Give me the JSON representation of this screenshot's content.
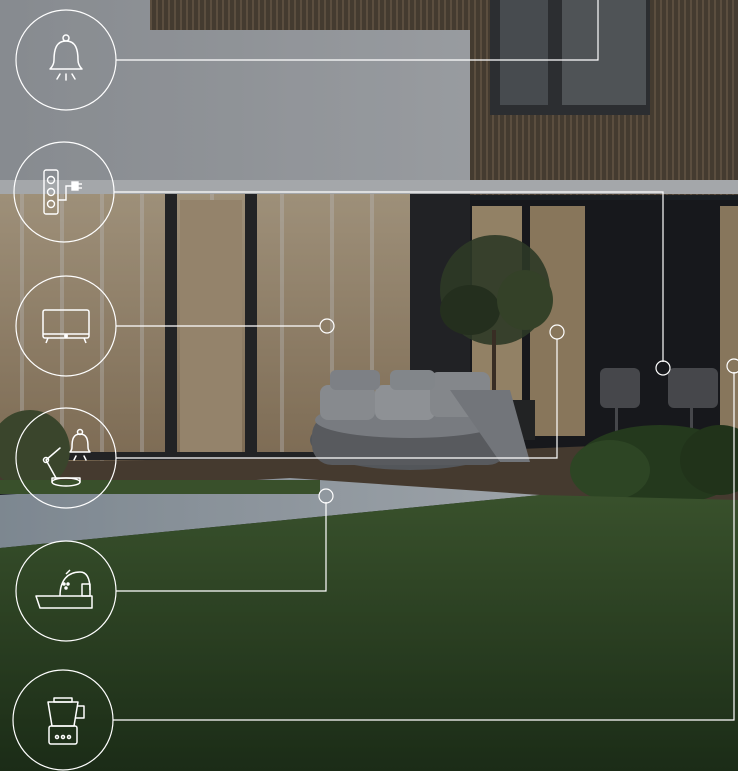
{
  "scene": {
    "description_free": true,
    "colors": {
      "upper_wall": "#c4c7cb",
      "wood_cladding": "#5a4e3e",
      "window_glow": "#e8d3b0",
      "night_glass": "#2a2c2f",
      "lawn": "#3a5a2c",
      "pool": "#b9c3cb",
      "line": "#ffffff"
    }
  },
  "icons": [
    {
      "name": "bell-icon"
    },
    {
      "name": "power-strip-icon"
    },
    {
      "name": "tv-icon"
    },
    {
      "name": "desk-lamp-bell-icon"
    },
    {
      "name": "kettle-icon"
    },
    {
      "name": "blender-icon"
    }
  ]
}
